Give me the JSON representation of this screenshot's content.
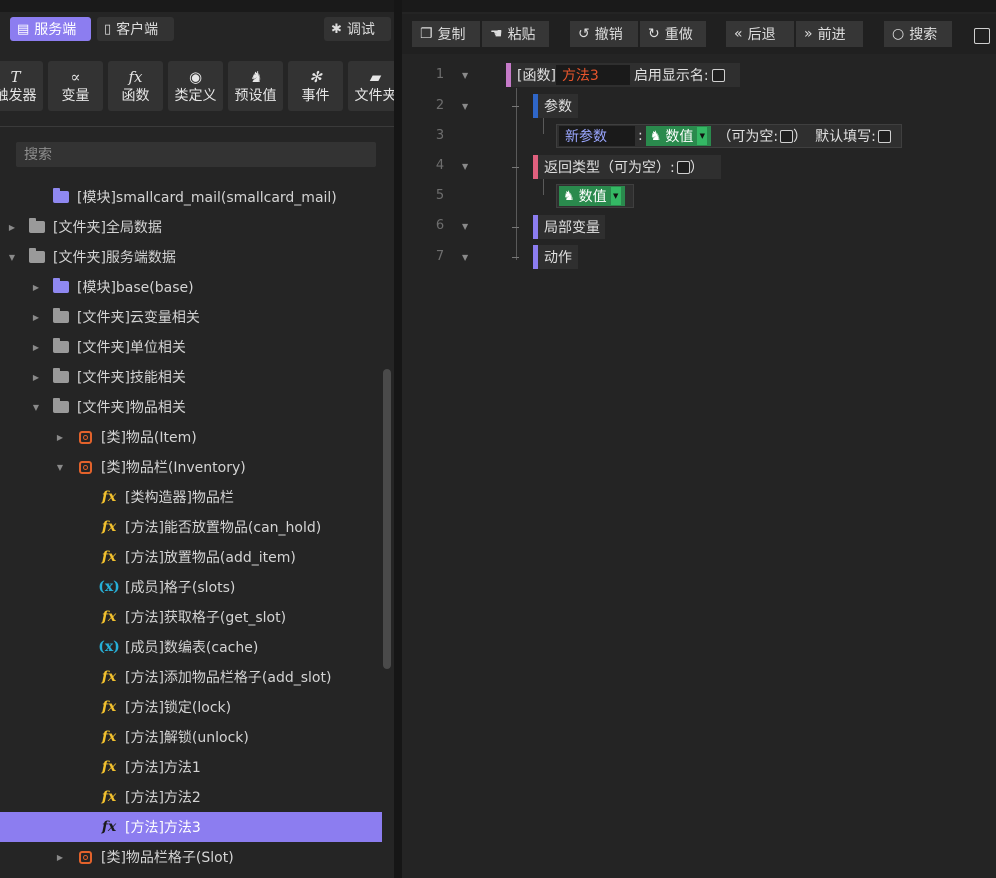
{
  "left": {
    "modes": {
      "server": "服务端",
      "client": "客户端",
      "debug": "调试"
    },
    "tools": [
      {
        "icon": "T",
        "label": "触发器"
      },
      {
        "icon": "∝",
        "label": "变量"
      },
      {
        "icon": "fx",
        "label": "函数"
      },
      {
        "icon": "◉",
        "label": "类定义"
      },
      {
        "icon": "♞",
        "label": "预设值"
      },
      {
        "icon": "✻",
        "label": "事件"
      },
      {
        "icon": "▰",
        "label": "文件夹"
      }
    ],
    "search_placeholder": "搜索",
    "tree": [
      {
        "label": "[模块]smallcard_mail(smallcard_mail)",
        "icon": "folder-purple"
      },
      {
        "label": "[文件夹]全局数据",
        "icon": "folder-gray",
        "arrow": "right"
      },
      {
        "label": "[文件夹]服务端数据",
        "icon": "folder-gray",
        "arrow": "down"
      },
      {
        "label": "[模块]base(base)",
        "icon": "folder-purple",
        "arrow": "right"
      },
      {
        "label": "[文件夹]云变量相关",
        "icon": "folder-gray",
        "arrow": "right"
      },
      {
        "label": "[文件夹]单位相关",
        "icon": "folder-gray",
        "arrow": "right"
      },
      {
        "label": "[文件夹]技能相关",
        "icon": "folder-gray",
        "arrow": "right"
      },
      {
        "label": "[文件夹]物品相关",
        "icon": "folder-gray",
        "arrow": "down"
      },
      {
        "label": "[类]物品(Item)",
        "icon": "class",
        "arrow": "right"
      },
      {
        "label": "[类]物品栏(Inventory)",
        "icon": "class",
        "arrow": "down"
      },
      {
        "label": "[类构造器]物品栏",
        "icon": "fx"
      },
      {
        "label": "[方法]能否放置物品(can_hold)",
        "icon": "fx"
      },
      {
        "label": "[方法]放置物品(add_item)",
        "icon": "fx"
      },
      {
        "label": "[成员]格子(slots)",
        "icon": "member"
      },
      {
        "label": "[方法]获取格子(get_slot)",
        "icon": "fx"
      },
      {
        "label": "[成员]数编表(cache)",
        "icon": "member"
      },
      {
        "label": "[方法]添加物品栏格子(add_slot)",
        "icon": "fx"
      },
      {
        "label": "[方法]锁定(lock)",
        "icon": "fx"
      },
      {
        "label": "[方法]解锁(unlock)",
        "icon": "fx"
      },
      {
        "label": "[方法]方法1",
        "icon": "fx"
      },
      {
        "label": "[方法]方法2",
        "icon": "fx"
      },
      {
        "label": "[方法]方法3",
        "icon": "fx",
        "selected": true
      },
      {
        "label": "[类]物品栏格子(Slot)",
        "icon": "class",
        "arrow": "right"
      }
    ]
  },
  "right": {
    "toolbar": {
      "copy": "复制",
      "paste": "粘贴",
      "undo": "撤销",
      "redo": "重做",
      "back": "后退",
      "forward": "前进",
      "search": "搜索"
    },
    "lines": [
      "1",
      "2",
      "3",
      "4",
      "5",
      "6",
      "7"
    ],
    "func_tag": "[函数]",
    "func_name": "方法3",
    "enable_display_name": "启用显示名:",
    "params_label": "参数",
    "param_name": "新参数",
    "colon": ":",
    "type_label": "数值",
    "nullable_open": "（可为空:",
    "nullable_close": "）",
    "default_fill": "默认填写:",
    "return_type_label": "返回类型（可为空）:",
    "return_close": "）",
    "local_vars_label": "局部变量",
    "actions_label": "动作"
  },
  "colors": {
    "accent": "#8c7df0",
    "type_green": "#2a8a4d",
    "func_name": "#e8552c"
  }
}
